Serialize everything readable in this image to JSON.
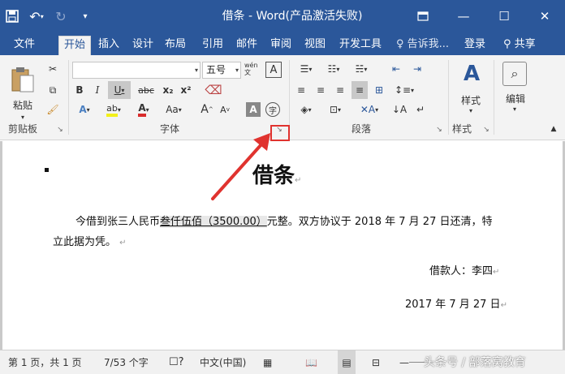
{
  "titlebar": {
    "title": "借条 - Word(产品激活失败)",
    "qat": [
      "save-icon",
      "undo-icon",
      "redo-icon",
      "customize-qat-icon"
    ],
    "window_buttons": [
      "ribbon-display-icon",
      "minimize-icon",
      "maximize-icon",
      "close-icon"
    ]
  },
  "tabs": [
    "文件",
    "开始",
    "插入",
    "设计",
    "布局",
    "引用",
    "邮件",
    "审阅",
    "视图",
    "开发工具"
  ],
  "active_tab": "开始",
  "tell_me": "告诉我...",
  "login": "登录",
  "share": "共享",
  "ribbon": {
    "clipboard": {
      "label": "剪贴板",
      "paste": "粘贴"
    },
    "font": {
      "label": "字体",
      "font_name": "",
      "font_size": "五号",
      "pinyin": "wén 文",
      "border_char": "A",
      "bold": "B",
      "italic": "I",
      "underline": "U",
      "strike": "abc",
      "subscript": "x₂",
      "superscript": "x²",
      "aa": "Aa",
      "grow": "A",
      "shrink": "A",
      "enclose": "字"
    },
    "paragraph": {
      "label": "段落"
    },
    "styles": {
      "label": "样式",
      "button": "样式"
    },
    "editing": {
      "button": "编辑"
    }
  },
  "document": {
    "title": "借条",
    "para_before": "今借到张三人民币",
    "para_amount": "叁仟伍佰（3500.00）",
    "para_after": "元整。双方协议于 2018 年 7 月 27 日还清，特",
    "para_line2": "立此据为凭。",
    "borrower": "借款人：李四",
    "date": "2017 年 7 月 27 日"
  },
  "statusbar": {
    "page": "第 1 页，共 1 页",
    "words": "7/53 个字",
    "language": "中文(中国)",
    "zoom_label": "",
    "watermark": "头条号 / 部落窝教育"
  },
  "colors": {
    "accent": "#2b579a",
    "highlight": "#e0332f"
  }
}
